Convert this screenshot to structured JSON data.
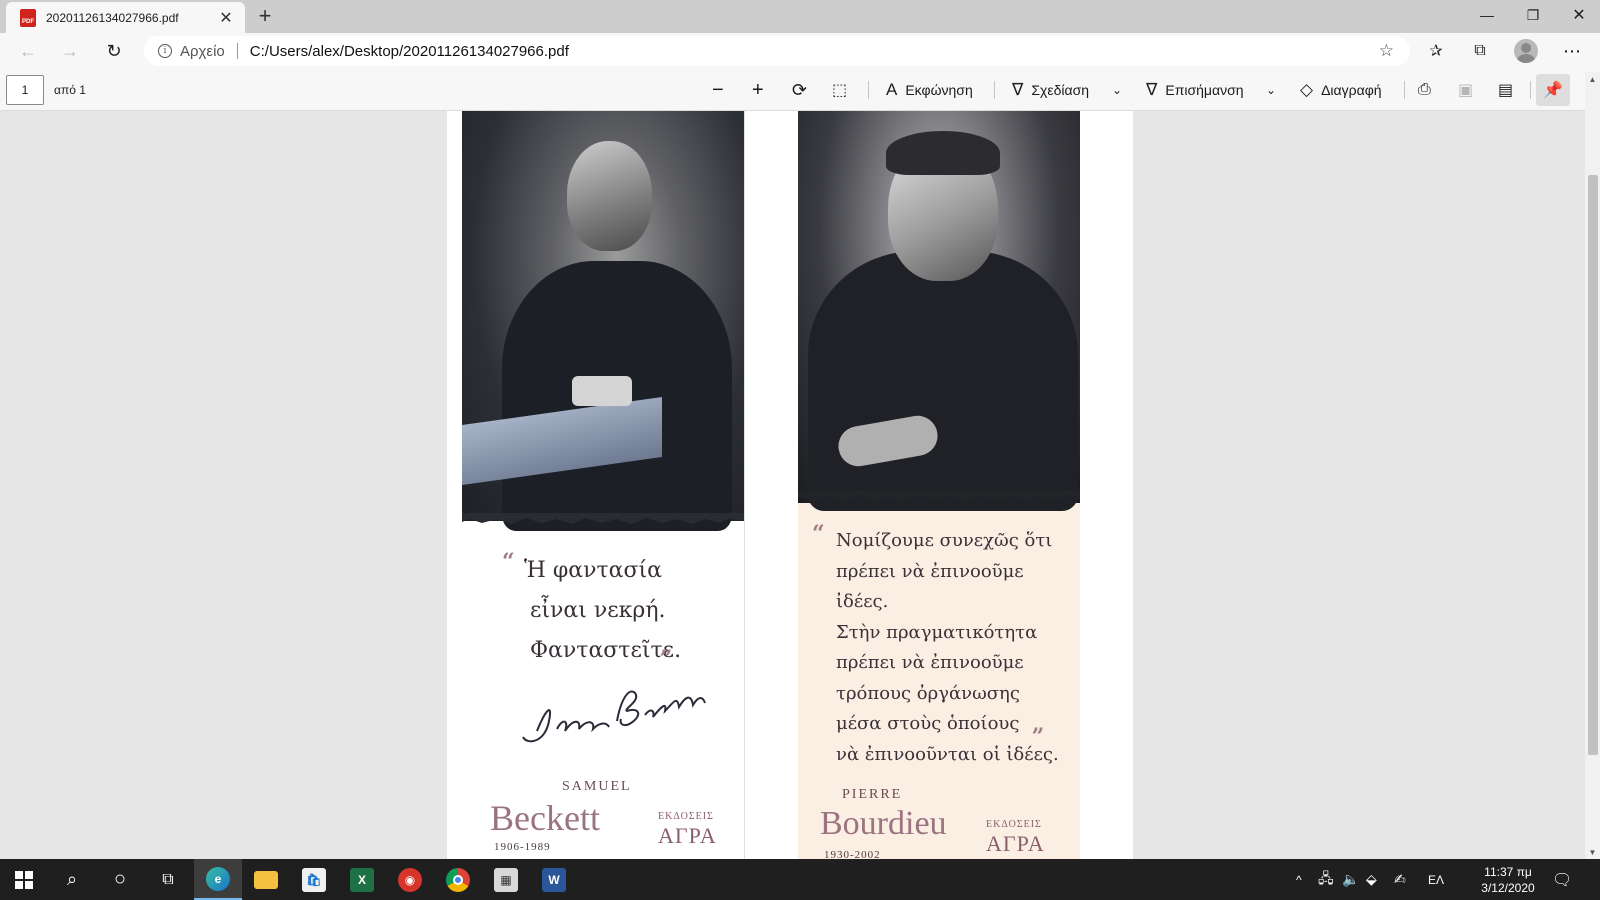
{
  "browser": {
    "tab": {
      "title": "20201126134027966.pdf",
      "icon": "pdf-file-icon"
    },
    "address": {
      "scheme_label": "Αρχείο",
      "url": "C:/Users/alex/Desktop/20201126134027966.pdf"
    }
  },
  "pdf_toolbar": {
    "page_number": "1",
    "page_count": "από 1",
    "read_aloud": "Εκφώνηση",
    "draw": "Σχεδίαση",
    "highlight": "Επισήμανση",
    "erase": "Διαγραφή"
  },
  "document": {
    "left_bookmark": {
      "quote_lines": [
        "Ἡ φαντασία",
        "εἶναι νεκρή.",
        "Φανταστεῖτε."
      ],
      "signature": "Sam Beckett",
      "author_first": "SAMUEL",
      "author_last": "Beckett",
      "years": "1906-1989",
      "publisher_small": "ΕΚΔΟΣΕΙΣ",
      "publisher_big": "ΑΓΡΑ"
    },
    "right_bookmark": {
      "quote_lines": [
        "Νομίζουμε συνεχῶς ὅτι",
        "πρέπει νὰ ἐπινοοῦμε ἰδέες.",
        "Στὴν πραγματικότητα",
        "πρέπει νὰ ἐπινοοῦμε",
        "τρόπους ὀργάνωσης",
        "μέσα στοὺς ὁποίους",
        "νὰ ἐπινοοῦνται οἱ ἰδέες."
      ],
      "author_first": "PIERRE",
      "author_last": "Bourdieu",
      "years": "1930-2002",
      "publisher_small": "ΕΚΔΟΣΕΙΣ",
      "publisher_big": "ΑΓΡΑ"
    }
  },
  "taskbar": {
    "language": "ΕΛ",
    "time": "11:37 πμ",
    "date": "3/12/2020"
  },
  "colors": {
    "accent_taskbar": "#76b9ed",
    "pdf_icon": "#d0231c",
    "bookmark_right_bg": "#fbeee2",
    "quote_mark": "#a07c86"
  }
}
